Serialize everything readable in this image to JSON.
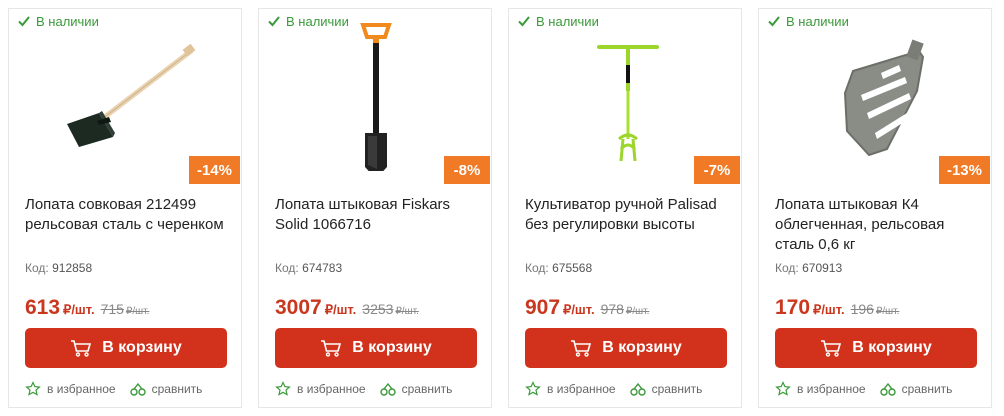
{
  "common": {
    "in_stock": "В наличии",
    "code_label": "Код:",
    "add_to_cart": "В корзину",
    "favorites": "в избранное",
    "compare": "сравнить",
    "accent_color": "#d2321c",
    "badge_color": "#f07a26",
    "stock_color": "#3a9a3a"
  },
  "products": [
    {
      "discount": "-14%",
      "title": "Лопата совковая 212499 рельсовая сталь с черенком",
      "code": "912858",
      "price": "613",
      "unit": "₽/шт.",
      "old_price": "715",
      "old_unit": "₽/шт.",
      "image_icon": "shovel-scoop-icon"
    },
    {
      "discount": "-8%",
      "title": "Лопата штыковая Fiskars Solid 1066716",
      "code": "674783",
      "price": "3007",
      "unit": "₽/шт.",
      "old_price": "3253",
      "old_unit": "₽/шт.",
      "image_icon": "shovel-spade-icon"
    },
    {
      "discount": "-7%",
      "title": "Культиватор ручной Palisad без регулировки высоты",
      "code": "675568",
      "price": "907",
      "unit": "₽/шт.",
      "old_price": "978",
      "old_unit": "₽/шт.",
      "image_icon": "cultivator-icon"
    },
    {
      "discount": "-13%",
      "title": "Лопата штыковая К4 облегченная, рельсовая сталь 0,6 кг",
      "code": "670913",
      "price": "170",
      "unit": "₽/шт.",
      "old_price": "196",
      "old_unit": "₽/шт.",
      "image_icon": "shovel-blade-icon"
    }
  ]
}
